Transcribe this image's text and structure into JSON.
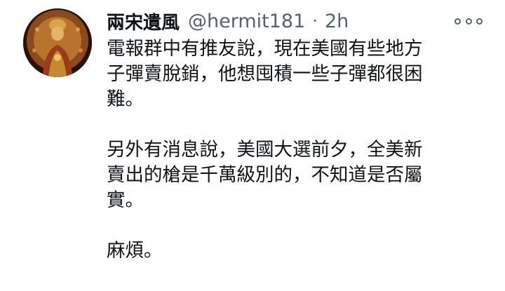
{
  "tweet": {
    "author": {
      "display_name": "兩宋遺風",
      "handle": "@hermit181",
      "separator": "·",
      "time": "2h"
    },
    "more_icon": "more-horizontal-icon",
    "paragraphs": [
      "電報群中有推友說，現在美國有些地方\n子彈賣脫銷，他想囤積一些子彈都很困\n難。",
      "另外有消息說，美國大選前夕，全美新\n賣出的槍是千萬級別的，不知道是否屬\n實。",
      "麻煩。"
    ],
    "colors": {
      "text": "#0f1419",
      "secondary": "#536471",
      "background": "#ffffff"
    }
  }
}
